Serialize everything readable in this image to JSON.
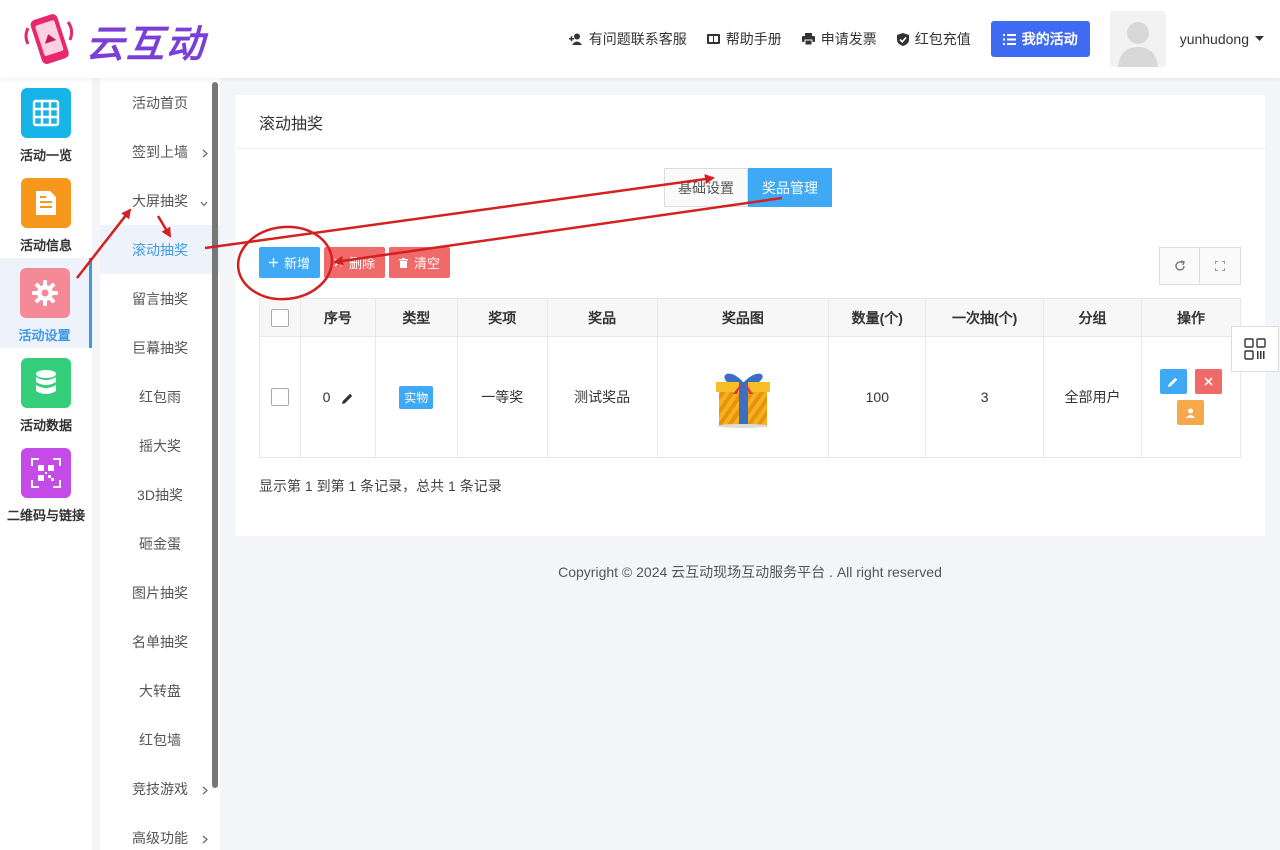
{
  "brand": {
    "name": "云互动",
    "color": "#7a3fd6"
  },
  "topnav": {
    "support": "有问题联系客服",
    "manual": "帮助手册",
    "invoice": "申请发票",
    "recharge": "红包充值",
    "my_activity": "我的活动",
    "username": "yunhudong"
  },
  "rail": [
    {
      "label": "活动一览",
      "icon": "grid-icon",
      "color": "#17b4e8"
    },
    {
      "label": "活动信息",
      "icon": "document-icon",
      "color": "#f7981c"
    },
    {
      "label": "活动设置",
      "icon": "gear-icon",
      "color": "#f48a98"
    },
    {
      "label": "活动数据",
      "icon": "database-icon",
      "color": "#35cf7c"
    },
    {
      "label": "二维码与链接",
      "icon": "qrcode-icon",
      "color": "#c54be8"
    }
  ],
  "submenu": [
    {
      "label": "活动首页",
      "chevron": ""
    },
    {
      "label": "签到上墙",
      "chevron": "›"
    },
    {
      "label": "大屏抽奖",
      "chevron": "ˇ"
    },
    {
      "label": "滚动抽奖",
      "chevron": ""
    },
    {
      "label": "留言抽奖",
      "chevron": ""
    },
    {
      "label": "巨幕抽奖",
      "chevron": ""
    },
    {
      "label": "红包雨",
      "chevron": ""
    },
    {
      "label": "摇大奖",
      "chevron": ""
    },
    {
      "label": "3D抽奖",
      "chevron": ""
    },
    {
      "label": "砸金蛋",
      "chevron": ""
    },
    {
      "label": "图片抽奖",
      "chevron": ""
    },
    {
      "label": "名单抽奖",
      "chevron": ""
    },
    {
      "label": "大转盘",
      "chevron": ""
    },
    {
      "label": "红包墙",
      "chevron": ""
    },
    {
      "label": "竞技游戏",
      "chevron": "›"
    },
    {
      "label": "高级功能",
      "chevron": "›"
    }
  ],
  "page": {
    "title": "滚动抽奖",
    "tabs": {
      "basic": "基础设置",
      "prizes": "奖品管理"
    },
    "toolbar": {
      "add": "新增",
      "delete": "删除",
      "clear": "清空"
    },
    "table": {
      "headers": [
        "序号",
        "类型",
        "奖项",
        "奖品",
        "奖品图",
        "数量(个)",
        "一次抽(个)",
        "分组",
        "操作"
      ],
      "rows": [
        {
          "seq": "0",
          "type": "实物",
          "level": "一等奖",
          "prize": "测试奖品",
          "qty": "100",
          "per_draw": "3",
          "group": "全部用户"
        }
      ]
    },
    "pagination": "显示第 1 到第 1 条记录，总共 1 条记录"
  },
  "footer": "Copyright © 2024 云互动现场互动服务平台 . All right reserved",
  "annotation_color": "#d42020"
}
